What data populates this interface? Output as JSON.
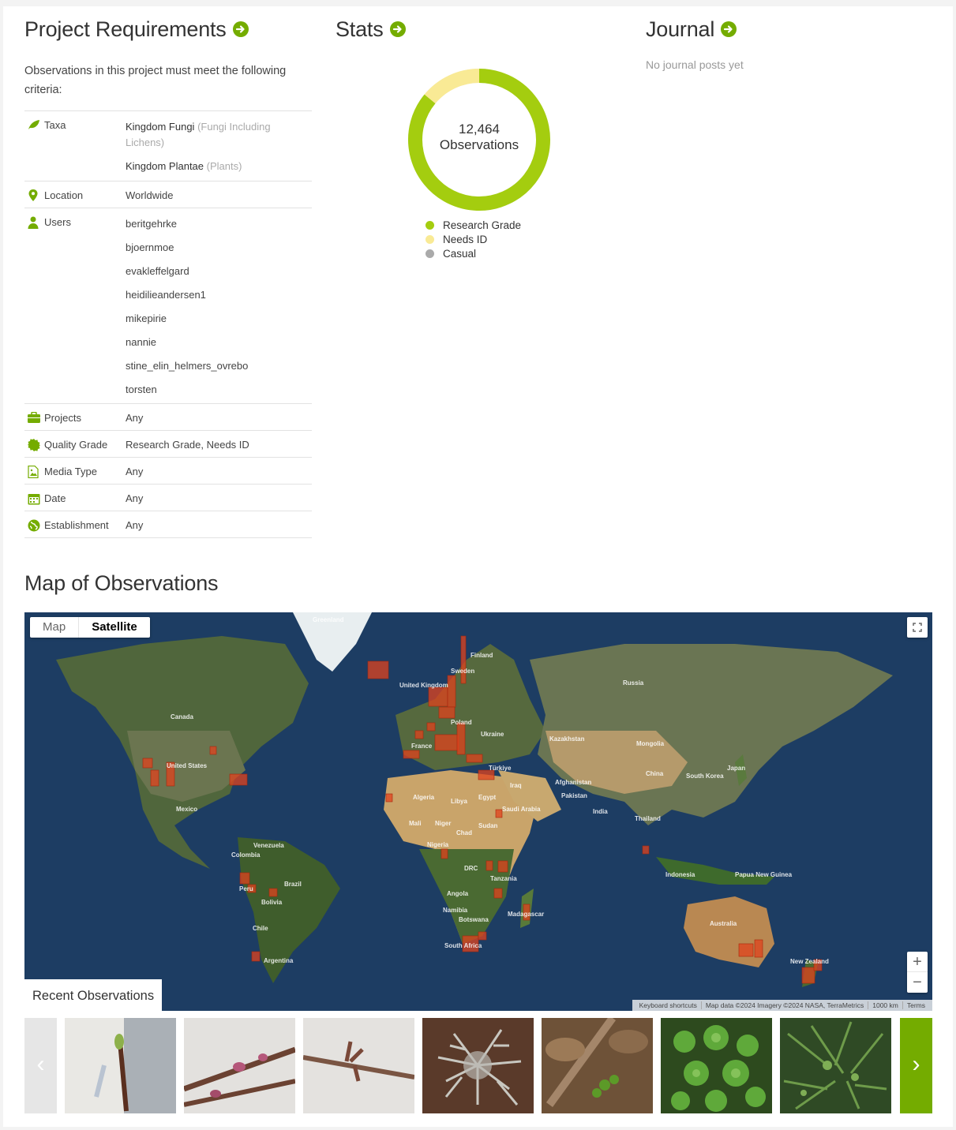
{
  "requirements": {
    "title": "Project Requirements",
    "intro": "Observations in this project must meet the following criteria:",
    "taxa_label": "Taxa",
    "taxa": [
      {
        "name": "Kingdom Fungi",
        "common": "(Fungi Including Lichens)"
      },
      {
        "name": "Kingdom Plantae",
        "common": "(Plants)"
      }
    ],
    "location_label": "Location",
    "location_value": "Worldwide",
    "users_label": "Users",
    "users": [
      "beritgehrke",
      "bjoernmoe",
      "evakleffelgard",
      "heidilieandersen1",
      "mikepirie",
      "nannie",
      "stine_elin_helmers_ovrebo",
      "torsten"
    ],
    "projects_label": "Projects",
    "projects_value": "Any",
    "quality_label": "Quality Grade",
    "quality_value": "Research Grade, Needs ID",
    "media_label": "Media Type",
    "media_value": "Any",
    "date_label": "Date",
    "date_value": "Any",
    "establishment_label": "Establishment",
    "establishment_value": "Any"
  },
  "stats": {
    "title": "Stats",
    "count": "12,464",
    "count_label": "Observations",
    "breakdown": [
      {
        "label": "Research Grade",
        "fraction": 0.86,
        "color": "#a4cd0f"
      },
      {
        "label": "Needs ID",
        "fraction": 0.14,
        "color": "#f9ea95"
      },
      {
        "label": "Casual",
        "fraction": 0.0,
        "color": "#aaaaaa"
      }
    ]
  },
  "journal": {
    "title": "Journal",
    "empty_text": "No journal posts yet"
  },
  "map": {
    "title": "Map of Observations",
    "map_option": "Map",
    "satellite_option": "Satellite",
    "selected_option": "Satellite",
    "zoom_in": "+",
    "zoom_out": "−",
    "attribution": [
      "Keyboard shortcuts",
      "Map data ©2024 Imagery ©2024 NASA, TerraMetrics",
      "1000 km",
      "Terms"
    ],
    "labels": [
      "Greenland",
      "Finland",
      "Sweden",
      "Russia",
      "United Kingdom",
      "Poland",
      "Ukraine",
      "France",
      "Kazakhstan",
      "Mongolia",
      "Canada",
      "United States",
      "Türkiye",
      "Iraq",
      "Afghanistan",
      "Pakistan",
      "China",
      "South Korea",
      "Japan",
      "Mexico",
      "Algeria",
      "Libya",
      "Egypt",
      "Saudi Arabia",
      "India",
      "Thailand",
      "Mali",
      "Niger",
      "Chad",
      "Sudan",
      "Venezuela",
      "Colombia",
      "Nigeria",
      "DRC",
      "Tanzania",
      "Brazil",
      "Peru",
      "Bolivia",
      "Angola",
      "Namibia",
      "Botswana",
      "Madagascar",
      "South Africa",
      "Indonesia",
      "Papua New Guinea",
      "Australia",
      "Chile",
      "Argentina",
      "New Zealand"
    ]
  },
  "recent": {
    "title": "Recent Observations",
    "prev": "‹",
    "next": "›",
    "thumbnails": [
      "twig-bud-on-paper",
      "branch-buds-pink",
      "branch-buds-bare",
      "grey-lichen",
      "seedling-on-leaf-litter",
      "green-clover-plants",
      "green-fern-groundcover"
    ]
  }
}
